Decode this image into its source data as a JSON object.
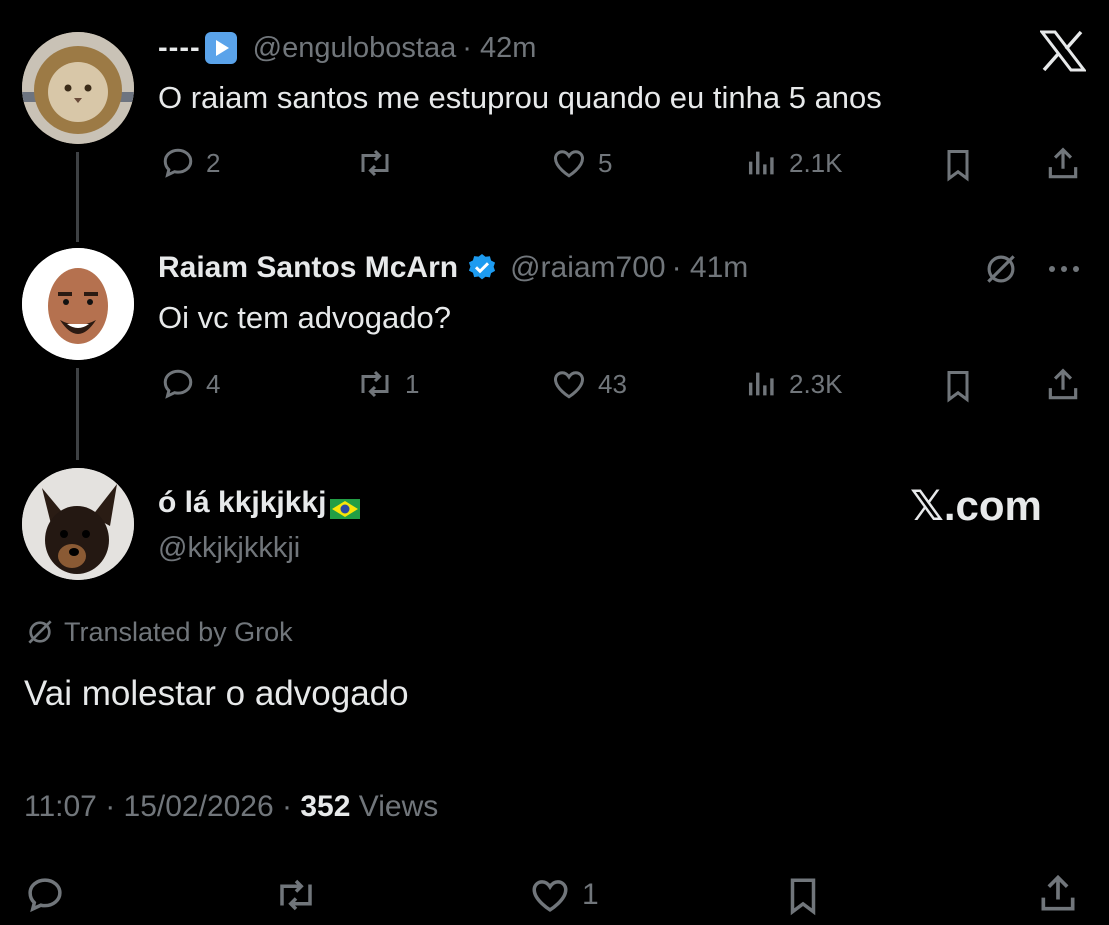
{
  "tweet1": {
    "display_name": "----",
    "handle": "@engulobostaa",
    "time": "· 42m",
    "text": "O raiam santos me estuprou quando eu tinha 5 anos",
    "replies": "2",
    "retweets": "",
    "likes": "5",
    "views": "2.1K"
  },
  "tweet2": {
    "display_name": "Raiam Santos McArn",
    "handle": "@raiam700",
    "time": "· 41m",
    "text": "Oi vc tem advogado?",
    "replies": "4",
    "retweets": "1",
    "likes": "43",
    "views": "2.3K"
  },
  "main": {
    "display_name": "ó lá kkjkjkkj",
    "handle": "@kkjkjkkkji",
    "watermark": "𝕏.com",
    "translated_label": "Translated by Grok",
    "text": "Vai molestar o advogado",
    "time": "11:07",
    "date": "15/02/2026",
    "views_count": "352",
    "views_label": "Views",
    "likes": "1"
  },
  "colors": {
    "background": "#000000",
    "text": "#e7e9ea",
    "secondary": "#71767b",
    "verified": "#1d9bf0"
  },
  "icons": [
    "x-logo-icon",
    "reply-icon",
    "retweet-icon",
    "like-icon",
    "views-icon",
    "bookmark-icon",
    "share-icon",
    "grok-icon",
    "more-icon",
    "verified-icon",
    "play-emoji-icon",
    "brazil-flag-icon"
  ]
}
